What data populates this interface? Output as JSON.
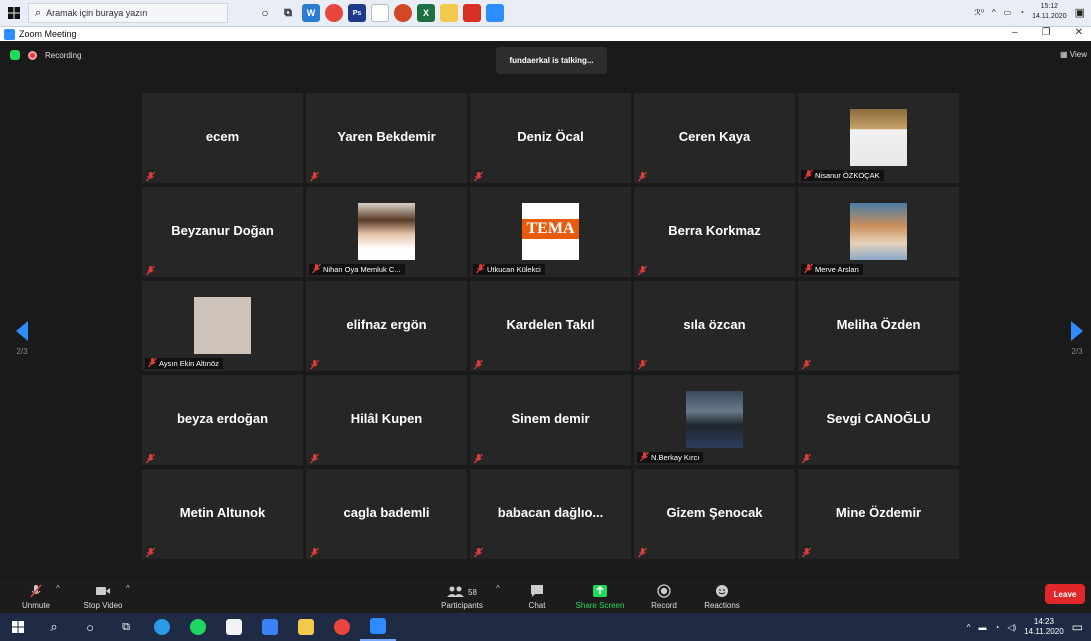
{
  "top_taskbar": {
    "search_placeholder": "Aramak için buraya yazın",
    "clock_time": "15:12",
    "clock_date": "14.11.2020",
    "tray_label": "ℛ⁰"
  },
  "window": {
    "title": "Zoom Meeting"
  },
  "meeting": {
    "recording_label": "Recording",
    "talking_label": "fundaerkal is talking...",
    "view_label": "View",
    "page_indicator_left": "2/3",
    "page_indicator_right": "2/3"
  },
  "participants": [
    {
      "name": "ecem",
      "video": false
    },
    {
      "name": "Yaren Bekdemir",
      "video": false
    },
    {
      "name": "Deniz Öcal",
      "video": false
    },
    {
      "name": "Ceren Kaya",
      "video": false
    },
    {
      "name": "Nisanur ÖZKOÇAK",
      "video": true
    },
    {
      "name": "Beyzanur Doğan",
      "video": false
    },
    {
      "name": "Nihan Oya Memluk C...",
      "video": true
    },
    {
      "name": "Utkucan Külekci",
      "video": true,
      "logo_text": "TEMA"
    },
    {
      "name": "Berra Korkmaz",
      "video": false
    },
    {
      "name": "Merve Arslan",
      "video": true
    },
    {
      "name": "Aysın Ekin Altınöz",
      "video": true
    },
    {
      "name": "elifnaz ergön",
      "video": false
    },
    {
      "name": "Kardelen Takıl",
      "video": false
    },
    {
      "name": "sıla özcan",
      "video": false
    },
    {
      "name": "Meliha Özden",
      "video": false
    },
    {
      "name": "beyza erdoğan",
      "video": false
    },
    {
      "name": "Hilâl Kupen",
      "video": false
    },
    {
      "name": "Sinem demir",
      "video": false
    },
    {
      "name": "N.Berkay Kırcı",
      "video": true
    },
    {
      "name": "Sevgi CANOĞLU",
      "video": false
    },
    {
      "name": "Metin Altunok",
      "video": false
    },
    {
      "name": "cagla bademli",
      "video": false
    },
    {
      "name": "babacan dağlıo...",
      "video": false
    },
    {
      "name": "Gizem Şenocak",
      "video": false
    },
    {
      "name": "Mine Özdemir",
      "video": false
    }
  ],
  "toolbar": {
    "unmute": "Unmute",
    "stop_video": "Stop Video",
    "participants": "Participants",
    "participants_count": "58",
    "chat": "Chat",
    "share_screen": "Share Screen",
    "record": "Record",
    "reactions": "Reactions",
    "leave": "Leave"
  },
  "bottom_taskbar": {
    "clock_time": "14:23",
    "clock_date": "14.11.2020"
  },
  "colors": {
    "zoom_blue": "#2d8cff",
    "share_green": "#23d959",
    "leave_red": "#e02828",
    "mic_red": "#e23c39"
  }
}
